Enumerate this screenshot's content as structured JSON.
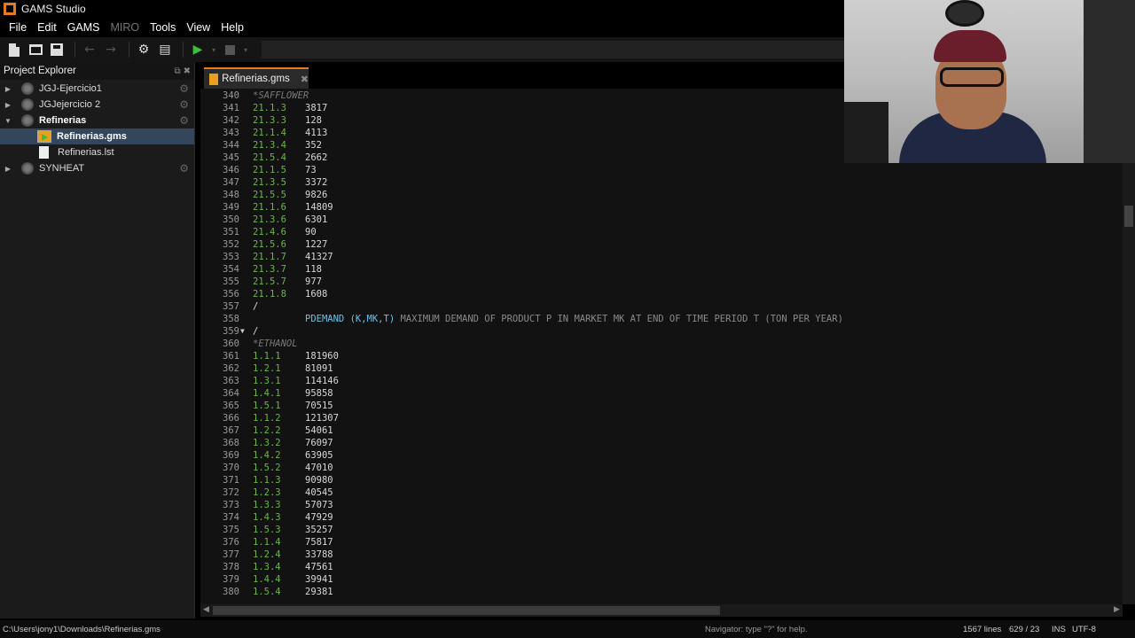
{
  "window": {
    "title": "GAMS Studio"
  },
  "menu": [
    "File",
    "Edit",
    "GAMS",
    "MIRO",
    "Tools",
    "View",
    "Help"
  ],
  "menu_disabled": [
    "MIRO"
  ],
  "toolbar_icons": [
    "new-file-icon",
    "open-folder-icon",
    "save-icon",
    "back-arrow-icon",
    "forward-arrow-icon",
    "settings-gear-icon",
    "library-icon",
    "run-play-icon",
    "dropdown-icon",
    "stop-icon",
    "dropdown-icon"
  ],
  "project_explorer": {
    "title": "Project Explorer",
    "items": [
      {
        "label": "JGJ-Ejercicio1",
        "level": 0,
        "expanded": false,
        "type": "project"
      },
      {
        "label": "JGJejercicio 2",
        "level": 0,
        "expanded": false,
        "type": "project"
      },
      {
        "label": "Refinerias",
        "level": 0,
        "expanded": true,
        "type": "project"
      },
      {
        "label": "Refinerias.gms",
        "level": 1,
        "type": "gms",
        "selected": true
      },
      {
        "label": "Refinerias.lst",
        "level": 1,
        "type": "lst"
      },
      {
        "label": "SYNHEAT",
        "level": 0,
        "expanded": false,
        "type": "project"
      }
    ]
  },
  "tab": {
    "label": "Refinerias.gms"
  },
  "editor_lines": [
    {
      "n": "340",
      "kind": "comment",
      "text": "*SAFFLOWER"
    },
    {
      "n": "341",
      "kind": "pair",
      "key": "21.1.3",
      "val": "3817"
    },
    {
      "n": "342",
      "kind": "pair",
      "key": "21.3.3",
      "val": "128"
    },
    {
      "n": "343",
      "kind": "pair",
      "key": "21.1.4",
      "val": "4113"
    },
    {
      "n": "344",
      "kind": "pair",
      "key": "21.3.4",
      "val": "352"
    },
    {
      "n": "345",
      "kind": "pair",
      "key": "21.5.4",
      "val": "2662"
    },
    {
      "n": "346",
      "kind": "pair",
      "key": "21.1.5",
      "val": "73"
    },
    {
      "n": "347",
      "kind": "pair",
      "key": "21.3.5",
      "val": "3372"
    },
    {
      "n": "348",
      "kind": "pair",
      "key": "21.5.5",
      "val": "9826"
    },
    {
      "n": "349",
      "kind": "pair",
      "key": "21.1.6",
      "val": "14809"
    },
    {
      "n": "350",
      "kind": "pair",
      "key": "21.3.6",
      "val": "6301"
    },
    {
      "n": "351",
      "kind": "pair",
      "key": "21.4.6",
      "val": "90"
    },
    {
      "n": "352",
      "kind": "pair",
      "key": "21.5.6",
      "val": "1227"
    },
    {
      "n": "353",
      "kind": "pair",
      "key": "21.1.7",
      "val": "41327"
    },
    {
      "n": "354",
      "kind": "pair",
      "key": "21.3.7",
      "val": "118"
    },
    {
      "n": "355",
      "kind": "pair",
      "key": "21.5.7",
      "val": "977"
    },
    {
      "n": "356",
      "kind": "pair",
      "key": "21.1.8",
      "val": "1608"
    },
    {
      "n": "357",
      "kind": "sym",
      "text": "/"
    },
    {
      "n": "358",
      "kind": "decl",
      "ident": "PDEMAND (K,MK,T)",
      "desc": "MAXIMUM DEMAND OF PRODUCT P IN MARKET MK AT END OF TIME PERIOD T (TON PER YEAR)"
    },
    {
      "n": "359",
      "kind": "sym",
      "text": "/",
      "fold": true
    },
    {
      "n": "360",
      "kind": "comment",
      "text": "*ETHANOL"
    },
    {
      "n": "361",
      "kind": "pair",
      "key": "1.1.1",
      "val": "181960"
    },
    {
      "n": "362",
      "kind": "pair",
      "key": "1.2.1",
      "val": "81091"
    },
    {
      "n": "363",
      "kind": "pair",
      "key": "1.3.1",
      "val": "114146"
    },
    {
      "n": "364",
      "kind": "pair",
      "key": "1.4.1",
      "val": "95858"
    },
    {
      "n": "365",
      "kind": "pair",
      "key": "1.5.1",
      "val": "70515"
    },
    {
      "n": "366",
      "kind": "pair",
      "key": "1.1.2",
      "val": "121307"
    },
    {
      "n": "367",
      "kind": "pair",
      "key": "1.2.2",
      "val": "54061"
    },
    {
      "n": "368",
      "kind": "pair",
      "key": "1.3.2",
      "val": "76097"
    },
    {
      "n": "369",
      "kind": "pair",
      "key": "1.4.2",
      "val": "63905"
    },
    {
      "n": "370",
      "kind": "pair",
      "key": "1.5.2",
      "val": "47010"
    },
    {
      "n": "371",
      "kind": "pair",
      "key": "1.1.3",
      "val": "90980"
    },
    {
      "n": "372",
      "kind": "pair",
      "key": "1.2.3",
      "val": "40545"
    },
    {
      "n": "373",
      "kind": "pair",
      "key": "1.3.3",
      "val": "57073"
    },
    {
      "n": "374",
      "kind": "pair",
      "key": "1.4.3",
      "val": "47929"
    },
    {
      "n": "375",
      "kind": "pair",
      "key": "1.5.3",
      "val": "35257"
    },
    {
      "n": "376",
      "kind": "pair",
      "key": "1.1.4",
      "val": "75817"
    },
    {
      "n": "377",
      "kind": "pair",
      "key": "1.2.4",
      "val": "33788"
    },
    {
      "n": "378",
      "kind": "pair",
      "key": "1.3.4",
      "val": "47561"
    },
    {
      "n": "379",
      "kind": "pair",
      "key": "1.4.4",
      "val": "39941"
    },
    {
      "n": "380",
      "kind": "pair",
      "key": "1.5.4",
      "val": "29381"
    }
  ],
  "status": {
    "path": "C:\\Users\\jony1\\Downloads\\Refinerias.gms",
    "navigator": "Navigator: type \"?\" for help.",
    "lines": "1567 lines",
    "position": "629 / 23",
    "mode": "INS",
    "encoding": "UTF-8"
  },
  "colors": {
    "accent": "#e87a1e",
    "keyword_green": "#6fb34a",
    "identifier_blue": "#6cc2e8",
    "selection": "#33465c",
    "run_green": "#3dbf3d"
  }
}
